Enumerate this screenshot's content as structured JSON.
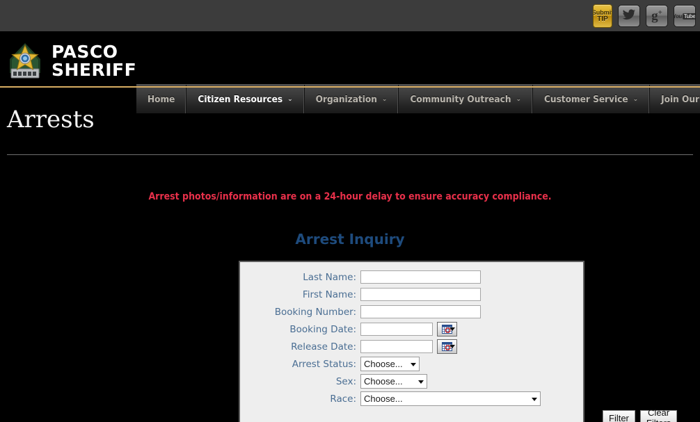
{
  "topbar": {
    "social": [
      {
        "name": "submit-tip",
        "line1": "Submit",
        "line2": "TIP"
      },
      {
        "name": "twitter",
        "glyph": "ᴠ"
      },
      {
        "name": "google-plus",
        "glyph": "g"
      },
      {
        "name": "youtube",
        "glyph": "You"
      }
    ]
  },
  "header": {
    "logo_line1": "PASCO",
    "logo_line2": "SHERIFF",
    "badge_icon": "sheriff-star-badge"
  },
  "nav": {
    "items": [
      {
        "label": "Home",
        "caret": "",
        "active": false
      },
      {
        "label": "Citizen Resources",
        "caret": "⌄",
        "active": true
      },
      {
        "label": "Organization",
        "caret": "⌄",
        "active": false
      },
      {
        "label": "Community Outreach",
        "caret": "⌄",
        "active": false
      },
      {
        "label": "Customer Service",
        "caret": "⌄",
        "active": false
      },
      {
        "label": "Join Our Team",
        "caret": "⌄",
        "active": false
      }
    ]
  },
  "page": {
    "title": "Arrests",
    "notice": "Arrest photos/information are on a 24-hour delay to ensure accuracy compliance.",
    "form_title": "Arrest Inquiry"
  },
  "form": {
    "fields": {
      "last_name": {
        "label": "Last Name:",
        "value": "",
        "placeholder": ""
      },
      "first_name": {
        "label": "First Name:",
        "value": "",
        "placeholder": ""
      },
      "booking_number": {
        "label": "Booking Number:",
        "value": "",
        "placeholder": ""
      },
      "booking_date": {
        "label": "Booking Date:",
        "value": "",
        "placeholder": ""
      },
      "release_date": {
        "label": "Release Date:",
        "value": "",
        "placeholder": ""
      },
      "arrest_status": {
        "label": "Arrest Status:",
        "value": "Choose..."
      },
      "sex": {
        "label": "Sex:",
        "value": "Choose..."
      },
      "race": {
        "label": "Race:",
        "value": "Choose..."
      }
    },
    "calendar_icon": "calendar-picker-icon",
    "buttons": {
      "filter": "Filter",
      "clear": "Clear Filters"
    }
  },
  "colors": {
    "accent_gold": "#d8ad63",
    "notice_red": "#e8304a",
    "heading_blue": "#1e4b7d",
    "label_blue": "#4a6e93",
    "panel_bg": "#eeeeee"
  }
}
